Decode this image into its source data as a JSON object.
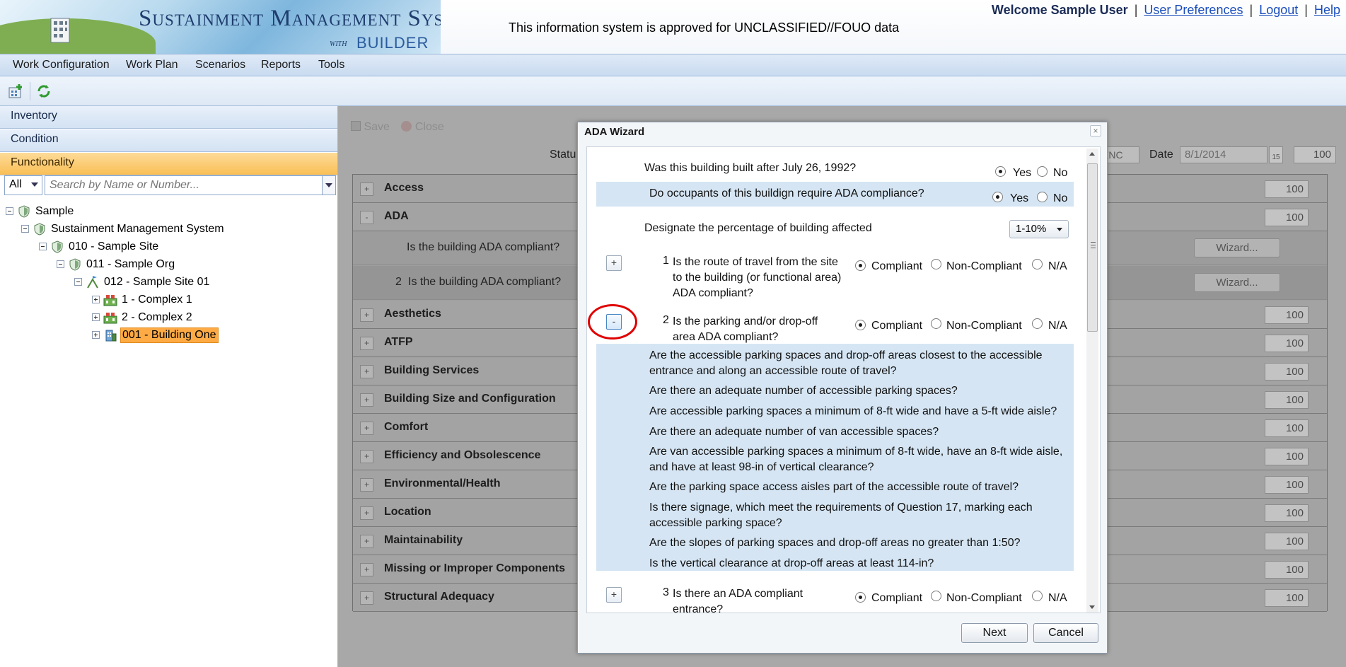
{
  "header": {
    "logo_title": "Sustainment Management Systems",
    "logo_with": "with",
    "logo_builder": "BUILDER",
    "banner": "This information system is approved for UNCLASSIFIED//FOUO data",
    "welcome": "Welcome Sample User",
    "links": [
      "User Preferences",
      "Logout",
      "Help"
    ]
  },
  "menu": [
    "Work Configuration",
    "Work Plan",
    "Scenarios",
    "Reports",
    "Tools"
  ],
  "toolbar_icons": [
    "add-icon",
    "refresh-icon"
  ],
  "left_panel": {
    "accordion": [
      "Inventory",
      "Condition",
      "Functionality"
    ],
    "active": "Functionality",
    "filter_value": "All",
    "search_placeholder": "Search by Name or Number...",
    "tree": [
      {
        "label": "Sample",
        "icon": "shield-icon"
      },
      {
        "label": "Sustainment Management System",
        "icon": "shield-icon"
      },
      {
        "label": "010 - Sample Site",
        "icon": "shield-icon"
      },
      {
        "label": "011 - Sample Org",
        "icon": "shield-icon"
      },
      {
        "label": "012 - Sample Site 01",
        "icon": "flag-icon"
      },
      {
        "label": "1 - Complex 1",
        "icon": "complex-icon"
      },
      {
        "label": "2 - Complex 2",
        "icon": "complex-icon"
      },
      {
        "label": "001 - Building One",
        "icon": "building-icon",
        "selected": true
      }
    ]
  },
  "main": {
    "save": "Save",
    "close": "Close",
    "status_label": "Statu",
    "hidden_select": "ENC",
    "date_label": "Date",
    "date_value": "8/1/2014",
    "calendar": "15",
    "overall_score": "100",
    "categories": [
      {
        "toggle": "+",
        "name": "Access",
        "score": "100"
      },
      {
        "toggle": "-",
        "name": "ADA",
        "score": "100"
      },
      {
        "toggle": "+",
        "name": "Aesthetics",
        "score": "100"
      },
      {
        "toggle": "+",
        "name": "ATFP",
        "score": "100"
      },
      {
        "toggle": "+",
        "name": "Building Services",
        "score": "100"
      },
      {
        "toggle": "+",
        "name": "Building Size and Configuration",
        "score": "100"
      },
      {
        "toggle": "+",
        "name": "Comfort",
        "score": "100"
      },
      {
        "toggle": "+",
        "name": "Efficiency and Obsolescence",
        "score": "100"
      },
      {
        "toggle": "+",
        "name": "Environmental/Health",
        "score": "100"
      },
      {
        "toggle": "+",
        "name": "Location",
        "score": "100"
      },
      {
        "toggle": "+",
        "name": "Maintainability",
        "score": "100"
      },
      {
        "toggle": "+",
        "name": "Missing or Improper Components",
        "score": "100"
      },
      {
        "toggle": "+",
        "name": "Structural Adequacy",
        "score": "100"
      }
    ],
    "ada_questions": [
      {
        "num": "",
        "text": "Is the building ADA compliant?",
        "button": "Wizard..."
      },
      {
        "num": "2",
        "text": "Is the building ADA compliant?",
        "button": "Wizard..."
      }
    ]
  },
  "modal": {
    "title": "ADA Wizard",
    "close": "×",
    "q_built": "Was this building built after July 26, 1992?",
    "q_occupants": "Do occupants of this buildign require ADA compliance?",
    "yes": "Yes",
    "no": "No",
    "q_percent": "Designate the percentage of building affected",
    "percent_value": "1-10%",
    "compliant": "Compliant",
    "non_compliant": "Non-Compliant",
    "na": "N/A",
    "questions": [
      {
        "num": "1",
        "toggle": "+",
        "lines": [
          "Is the route of travel from the site",
          "to the building (or functional area)",
          "ADA compliant?"
        ],
        "answer": "Compliant"
      },
      {
        "num": "2",
        "toggle": "-",
        "lines": [
          "Is the parking and/or drop-off",
          "area ADA compliant?"
        ],
        "answer": "Compliant"
      },
      {
        "num": "3",
        "toggle": "+",
        "lines": [
          "Is there an ADA compliant",
          "entrance?"
        ],
        "answer": "Compliant"
      }
    ],
    "sub_questions": [
      "Are the accessible parking spaces and drop-off areas closest to the accessible entrance and along an accessible route of travel?",
      "Are there an adequate number of accessible parking spaces?",
      "Are accessible parking spaces a minimum of 8-ft wide and have a 5-ft wide aisle?",
      "Are there an adequate number of van accessible spaces?",
      "Are van accessible parking spaces a minimum of 8-ft wide, have an 8-ft wide aisle, and have at least 98-in of vertical clearance?",
      "Are the parking space access aisles part of the accessible route of travel?",
      "Is there signage, which meet the requirements of Question 17, marking each accessible parking space?",
      "Are the slopes of parking spaces and drop-off areas no greater than 1:50?",
      "Is the vertical clearance at drop-off areas at least 114-in?"
    ],
    "next": "Next",
    "cancel": "Cancel"
  }
}
